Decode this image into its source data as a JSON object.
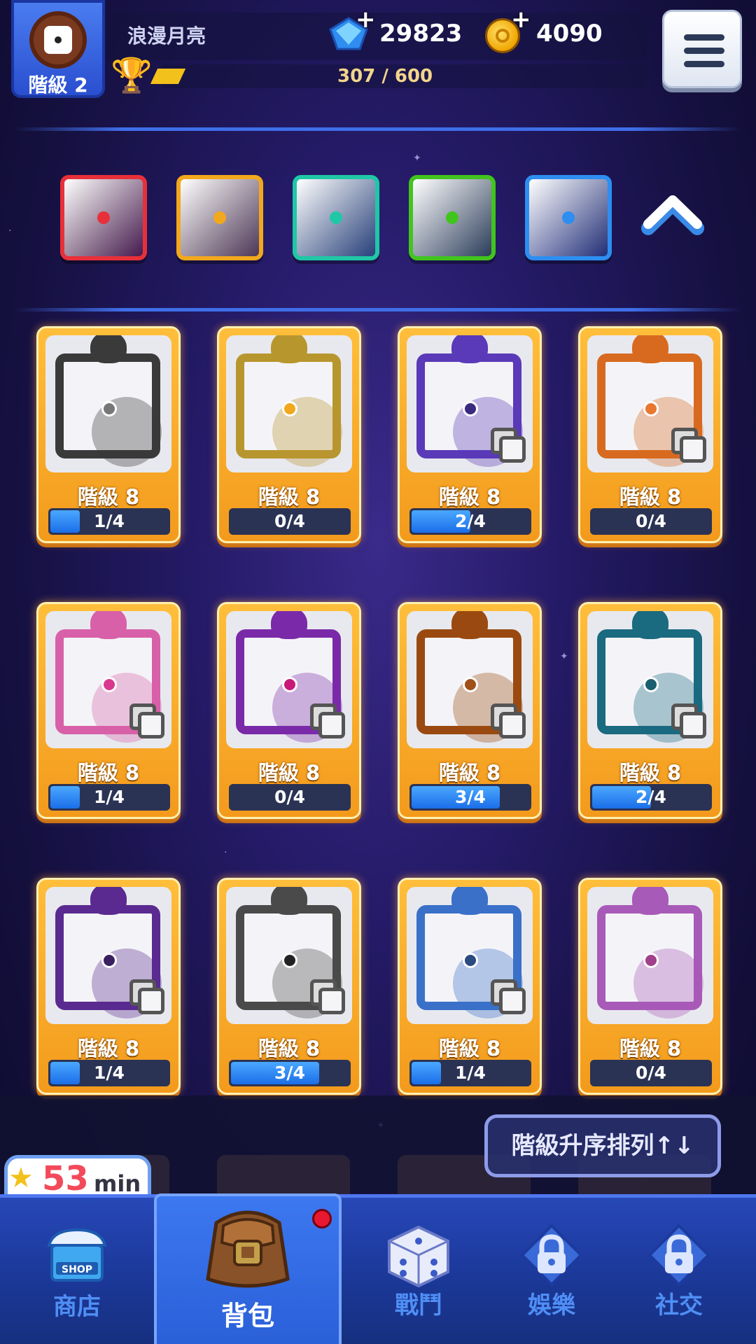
{
  "header": {
    "rank_label": "階級 2",
    "player_name": "浪漫月亮",
    "gems": "29823",
    "coins": "4090",
    "xp_text": "307 / 600"
  },
  "dice_selector": {
    "colors": [
      "#e8303a",
      "#f2a81d",
      "#20c7a6",
      "#42c41e",
      "#2e8ef0"
    ]
  },
  "cards": [
    {
      "level": "階級 8",
      "progress_text": "1/4",
      "fill": 0.25,
      "color": "#3a3a3a",
      "pip": "#777777"
    },
    {
      "level": "階級 8",
      "progress_text": "0/4",
      "fill": 0,
      "color": "#b8962e",
      "pip": "#f2a81d"
    },
    {
      "level": "階級 8",
      "progress_text": "2/4",
      "fill": 0.5,
      "color": "#5a3ab8",
      "pip": "#3a2a80"
    },
    {
      "level": "階級 8",
      "progress_text": "0/4",
      "fill": 0,
      "color": "#d86a20",
      "pip": "#e87830"
    },
    {
      "level": "階級 8",
      "progress_text": "1/4",
      "fill": 0.25,
      "color": "#d860a8",
      "pip": "#d83890"
    },
    {
      "level": "階級 8",
      "progress_text": "0/4",
      "fill": 0,
      "color": "#7a2aa8",
      "pip": "#c81878"
    },
    {
      "level": "階級 8",
      "progress_text": "3/4",
      "fill": 0.75,
      "color": "#9a4a10",
      "pip": "#a05018"
    },
    {
      "level": "階級 8",
      "progress_text": "2/4",
      "fill": 0.5,
      "color": "#1a6a80",
      "pip": "#1a6070"
    },
    {
      "level": "階級 8",
      "progress_text": "1/4",
      "fill": 0.25,
      "color": "#5a2a90",
      "pip": "#3a2060"
    },
    {
      "level": "階級 8",
      "progress_text": "3/4",
      "fill": 0.75,
      "color": "#4a4a4a",
      "pip": "#222222"
    },
    {
      "level": "階級 8",
      "progress_text": "1/4",
      "fill": 0.25,
      "color": "#3a70c8",
      "pip": "#2a4a80"
    },
    {
      "level": "階級 8",
      "progress_text": "0/4",
      "fill": 0,
      "color": "#a85ab8",
      "pip": "#a0408a"
    }
  ],
  "sort_button_label": "階級升序排列↑↓",
  "timer": {
    "value": "53",
    "unit": "min"
  },
  "nav": {
    "shop": "商店",
    "shop_sign": "SHOP",
    "backpack": "背包",
    "battle": "戰鬥",
    "entertainment": "娛樂",
    "social": "社交"
  }
}
